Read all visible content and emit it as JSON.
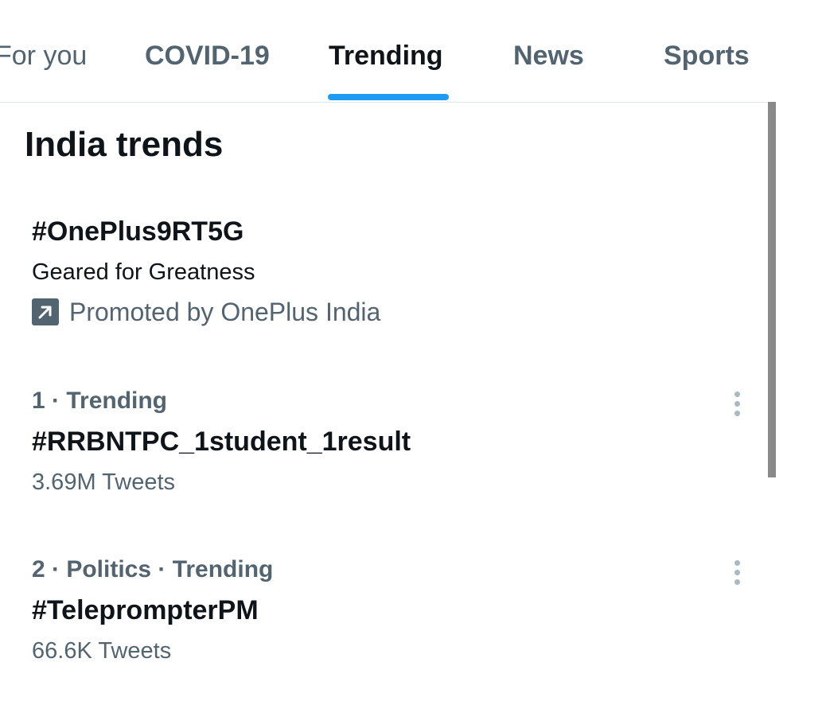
{
  "tabs": [
    {
      "label": "For you",
      "active": false
    },
    {
      "label": "COVID-19",
      "active": false
    },
    {
      "label": "Trending",
      "active": true
    },
    {
      "label": "News",
      "active": false
    },
    {
      "label": "Sports",
      "active": false
    }
  ],
  "accent_color": "#1d9bf0",
  "section": {
    "title": "India trends"
  },
  "promoted": {
    "hashtag": "#OnePlus9RT5G",
    "description": "Geared for Greatness",
    "icon": "promoted-arrow-icon",
    "promoted_text": "Promoted by OnePlus India"
  },
  "trends": [
    {
      "meta": "1 · Trending",
      "hashtag": "#RRBNTPC_1student_1result",
      "count": "3.69M Tweets",
      "menu_icon": "more-vertical-icon"
    },
    {
      "meta": "2 · Politics · Trending",
      "hashtag": "#TeleprompterPM",
      "count": "66.6K Tweets",
      "menu_icon": "more-vertical-icon"
    }
  ]
}
